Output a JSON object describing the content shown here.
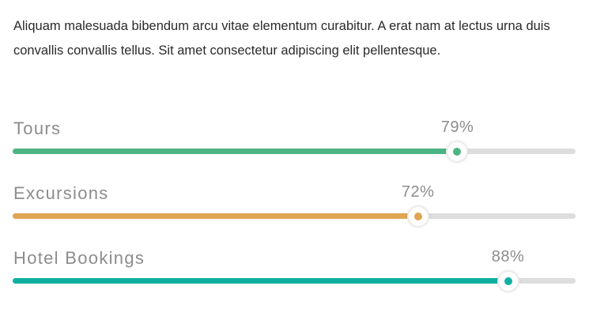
{
  "intro": {
    "text": "Aliquam malesuada bibendum arcu vitae elementum curabitur. A erat nam at lectus urna duis convallis convallis tellus. Sit amet consectetur adipiscing elit pellentesque."
  },
  "skills": [
    {
      "label": "Tours",
      "percent_text": "79%",
      "value": 79,
      "color": "#4cb482"
    },
    {
      "label": "Excursions",
      "percent_text": "72%",
      "value": 72,
      "color": "#e0a552"
    },
    {
      "label": "Hotel Bookings",
      "percent_text": "88%",
      "value": 88,
      "color": "#0fb0a2"
    }
  ]
}
